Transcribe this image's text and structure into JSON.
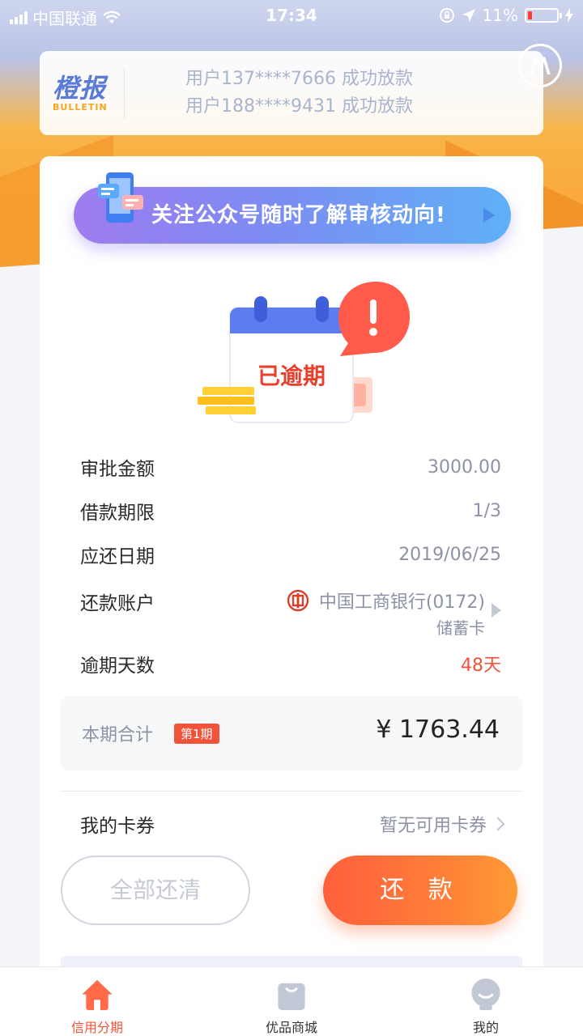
{
  "status_bar": {
    "carrier": "中国联通",
    "time": "17:34",
    "battery": "11%",
    "battery_level": 0.11
  },
  "bulletin": {
    "logo_title": "橙报",
    "logo_sub": "BULLETIN",
    "items": [
      "用户137****7666 成功放款",
      "用户188****9431 成功放款"
    ]
  },
  "banner": {
    "text": "关注公众号随时了解审核动向!"
  },
  "status": {
    "label": "已逾期"
  },
  "details": {
    "approved_amount_label": "审批金额",
    "approved_amount": "3000.00",
    "term_label": "借款期限",
    "term": "1/3",
    "due_date_label": "应还日期",
    "due_date": "2019/06/25",
    "account_label": "还款账户",
    "account_bank": "中国工商银行(0172)",
    "account_type": "储蓄卡",
    "overdue_label": "逾期天数",
    "overdue_days": "48天"
  },
  "total": {
    "label": "本期合计",
    "period_badge": "第1期",
    "amount": "¥ 1763.44"
  },
  "coupon": {
    "label": "我的卡券",
    "value": "暂无可用卡券"
  },
  "buttons": {
    "pay_all": "全部还清",
    "repay": "还 款"
  },
  "tabs": [
    {
      "label": "信用分期",
      "active": true
    },
    {
      "label": "优品商城",
      "active": false
    },
    {
      "label": "我的",
      "active": false
    }
  ],
  "colors": {
    "accent": "#f0533a",
    "primary_gradient_start": "#ff5f3c",
    "banner_start": "#9f7cf0"
  }
}
